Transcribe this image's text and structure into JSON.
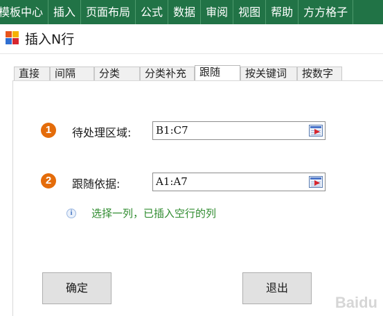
{
  "ribbon": {
    "tabs": [
      "模板中心",
      "插入",
      "页面布局",
      "公式",
      "数据",
      "审阅",
      "视图",
      "帮助",
      "方方格子"
    ]
  },
  "dialog": {
    "title": "插入N行",
    "tabs": [
      {
        "label": "直接",
        "active": false
      },
      {
        "label": "间隔",
        "active": false
      },
      {
        "label": "分类",
        "active": false
      },
      {
        "label": "分类补充",
        "active": false
      },
      {
        "label": "跟随",
        "active": true
      },
      {
        "label": "按关键词",
        "active": false
      },
      {
        "label": "按数字",
        "active": false
      }
    ],
    "field1": {
      "badge": "1",
      "label": "待处理区域:",
      "value": "B1:C7"
    },
    "field2": {
      "badge": "2",
      "label": "跟随依据:",
      "value": "A1:A7"
    },
    "hint": {
      "icon": "i",
      "text": "选择一列，已插入空行的列"
    },
    "ok_label": "确定",
    "exit_label": "退出"
  },
  "colors": {
    "ribbon": "#217346",
    "badge": "#e46c0a",
    "hint": "#2e8b2e"
  },
  "watermark": "Baidu"
}
